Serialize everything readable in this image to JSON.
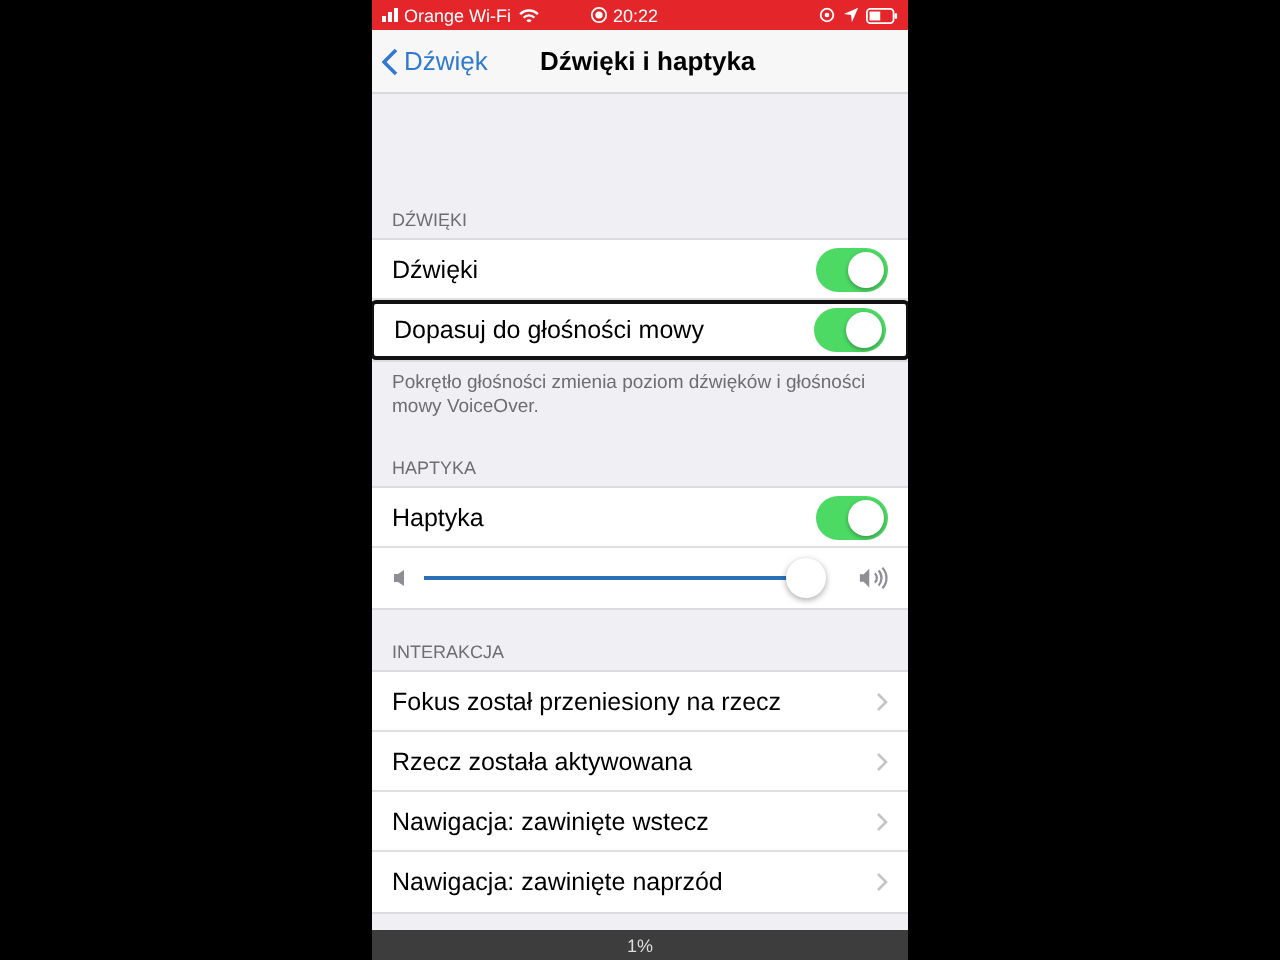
{
  "status_bar": {
    "carrier": "Orange Wi-Fi",
    "time": "20:22"
  },
  "nav": {
    "back": "Dźwięk",
    "title": "Dźwięki i haptyka"
  },
  "sections": [
    {
      "header": "DŹWIĘKI",
      "footer": "Pokrętło głośności zmienia poziom dźwięków i głośności mowy VoiceOver.",
      "rows": [
        {
          "kind": "toggle",
          "label": "Dźwięki",
          "on": true,
          "focused": false
        },
        {
          "kind": "toggle",
          "label": "Dopasuj do głośności mowy",
          "on": true,
          "focused": true
        }
      ]
    },
    {
      "header": "HAPTYKA",
      "rows": [
        {
          "kind": "toggle",
          "label": "Haptyka",
          "on": true,
          "focused": false
        },
        {
          "kind": "slider",
          "level": 0.97
        }
      ]
    },
    {
      "header": "INTERAKCJA",
      "rows": [
        {
          "kind": "link",
          "label": "Fokus został przeniesiony na rzecz"
        },
        {
          "kind": "link",
          "label": "Rzecz została aktywowana"
        },
        {
          "kind": "link",
          "label": "Nawigacja: zawinięte wstecz"
        },
        {
          "kind": "link",
          "label": "Nawigacja: zawinięte naprzód"
        }
      ]
    }
  ],
  "bottom_bar": {
    "text": "1%"
  }
}
